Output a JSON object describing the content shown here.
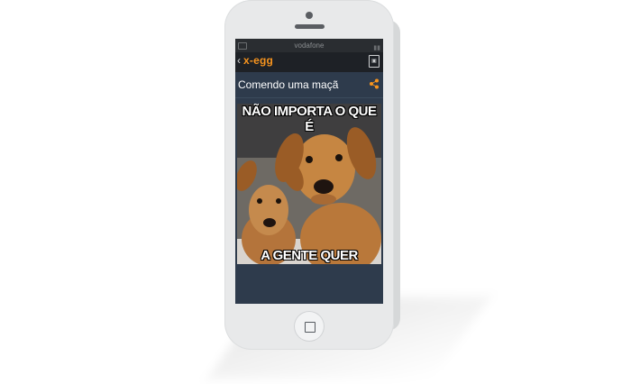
{
  "status": {
    "carrier": "vodafone"
  },
  "appbar": {
    "brand": "x-egg",
    "back_icon": "chevron-left-icon",
    "gallery_icon": "gallery-add-icon"
  },
  "post": {
    "title": "Comendo uma maçã",
    "share_icon": "share-icon",
    "meme_top_text": "NÃO IMPORTA O QUE É",
    "meme_bottom_text": "A GENTE QUER"
  },
  "colors": {
    "brand_accent": "#f7941e",
    "screen_bg": "#2e3b4c",
    "appbar_bg": "#1e2126"
  }
}
